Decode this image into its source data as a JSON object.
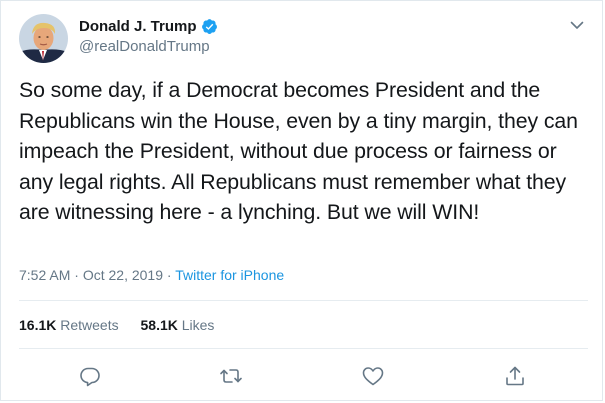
{
  "tweet": {
    "author": {
      "display_name": "Donald J. Trump",
      "handle": "@realDonaldTrump",
      "verified": true,
      "avatar_icon": "profile-photo"
    },
    "text": "So some day, if a Democrat becomes President and the Republicans win the House, even by a tiny margin, they can impeach the President, without due process or fairness or any legal rights. All Republicans must remember what they are witnessing here - a lynching. But we will WIN!",
    "time": "7:52 AM",
    "separator": " · ",
    "date": "Oct 22, 2019",
    "source": "Twitter for iPhone",
    "retweets": {
      "count": "16.1K",
      "label": "Retweets"
    },
    "likes": {
      "count": "58.1K",
      "label": "Likes"
    }
  },
  "actions": {
    "reply_icon": "reply-icon",
    "retweet_icon": "retweet-icon",
    "like_icon": "heart-icon",
    "share_icon": "share-icon",
    "more_icon": "chevron-down-icon"
  },
  "colors": {
    "text_primary": "#14171a",
    "text_secondary": "#657786",
    "link": "#1b95e0",
    "verified": "#1da1f2",
    "border": "#e1e8ed"
  }
}
